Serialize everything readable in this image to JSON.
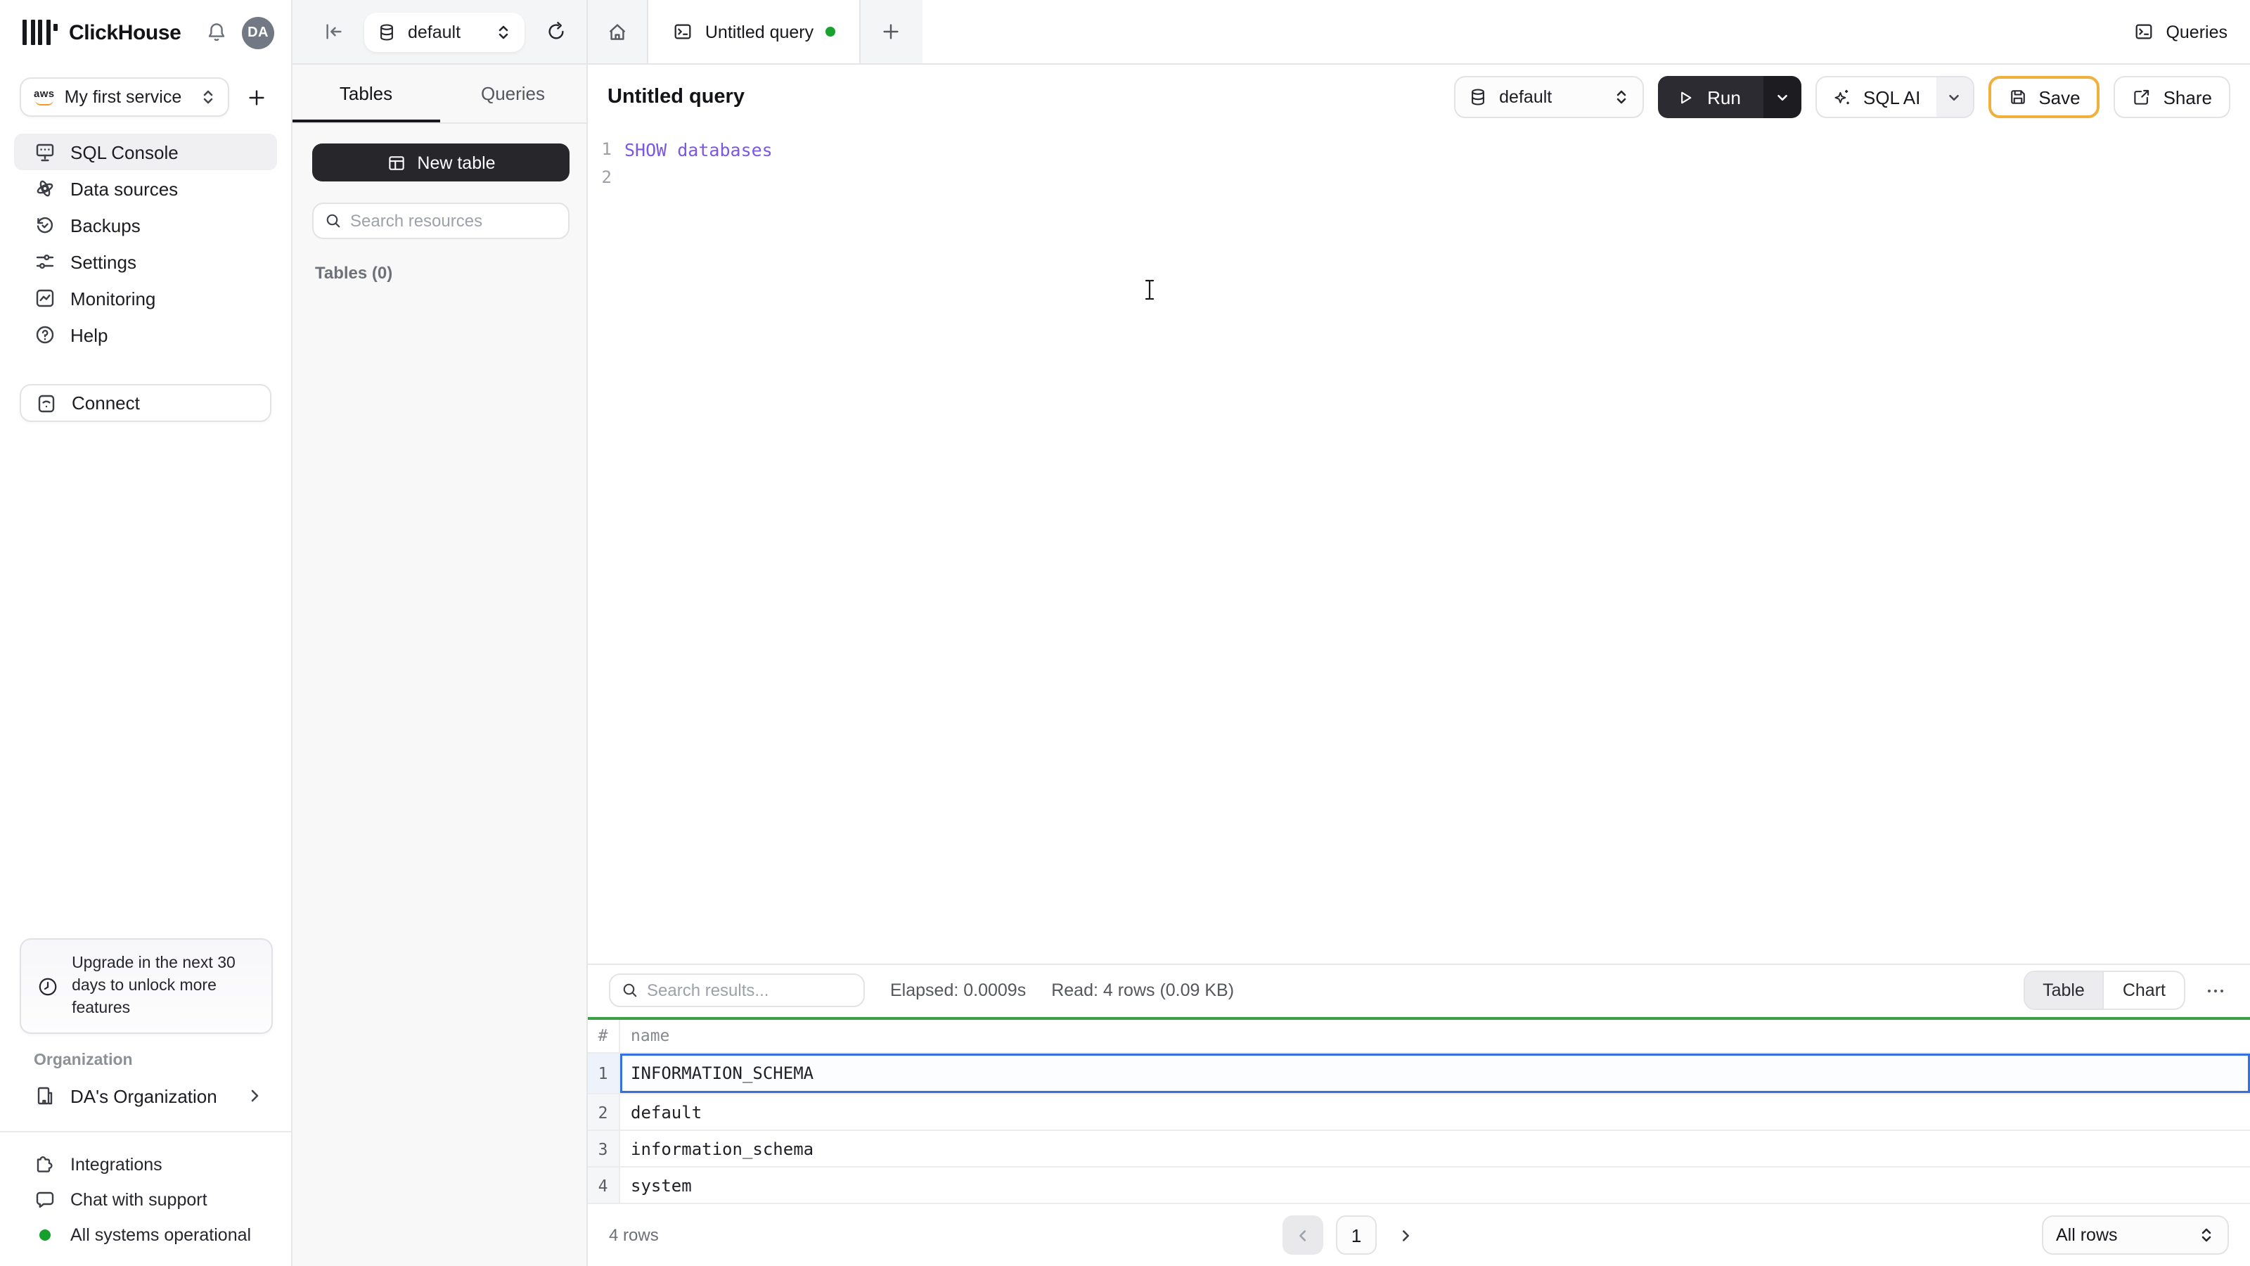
{
  "brand": {
    "name": "ClickHouse",
    "avatar_initials": "DA"
  },
  "sidebar": {
    "service": {
      "label": "My first service",
      "provider": "aws"
    },
    "items": [
      {
        "label": "SQL Console",
        "icon": "sql-console-icon",
        "active": true
      },
      {
        "label": "Data sources",
        "icon": "data-sources-icon"
      },
      {
        "label": "Backups",
        "icon": "backups-icon"
      },
      {
        "label": "Settings",
        "icon": "settings-icon"
      },
      {
        "label": "Monitoring",
        "icon": "monitoring-icon"
      },
      {
        "label": "Help",
        "icon": "help-icon"
      }
    ],
    "connect_label": "Connect",
    "upgrade_text": "Upgrade in the next 30 days to unlock more features",
    "organization": {
      "section_label": "Organization",
      "name": "DA's Organization"
    },
    "footer_items": [
      {
        "label": "Integrations",
        "icon": "puzzle-icon"
      },
      {
        "label": "Chat with support",
        "icon": "chat-icon"
      },
      {
        "label": "All systems operational",
        "icon": "status-dot",
        "status_color": "#169f2d"
      }
    ]
  },
  "topbar": {
    "database": "default",
    "tab": {
      "label": "Untitled query",
      "unsaved_dot_color": "#19a22e"
    },
    "queries_label": "Queries"
  },
  "explorer": {
    "tabs": [
      {
        "label": "Tables",
        "active": true
      },
      {
        "label": "Queries"
      }
    ],
    "new_table_label": "New table",
    "search_placeholder": "Search resources",
    "section_label": "Tables (0)"
  },
  "query": {
    "title": "Untitled query",
    "database": "default",
    "run_label": "Run",
    "sql_ai_label": "SQL AI",
    "save_label": "Save",
    "share_label": "Share"
  },
  "editor": {
    "lines": [
      {
        "num": "1",
        "code": "SHOW databases"
      },
      {
        "num": "2",
        "code": ""
      }
    ],
    "keyword_color": "#7b57e4"
  },
  "results": {
    "search_placeholder": "Search results...",
    "elapsed": "Elapsed: 0.0009s",
    "read": "Read: 4 rows (0.09 KB)",
    "view_tabs": [
      "Table",
      "Chart"
    ],
    "more_label": "...",
    "table": {
      "columns": [
        "#",
        "name"
      ],
      "rows": [
        {
          "n": "1",
          "name": "INFORMATION_SCHEMA",
          "selected": true
        },
        {
          "n": "2",
          "name": "default"
        },
        {
          "n": "3",
          "name": "information_schema"
        },
        {
          "n": "4",
          "name": "system"
        }
      ]
    },
    "footer": {
      "count": "4 rows",
      "page": "1",
      "page_size": "All rows"
    }
  },
  "colors": {
    "success_green": "#3da044",
    "tab_dot_green": "#19a22e",
    "save_border_orange": "#f0b03c",
    "selection_blue": "#3470de",
    "keyword_purple": "#7b57e4"
  }
}
